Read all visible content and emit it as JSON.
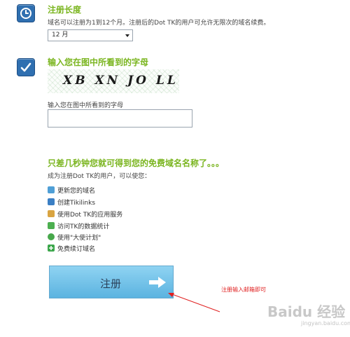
{
  "sections": {
    "duration": {
      "title": "注册长度",
      "description": "域名可以注册为1到12个月。注册后的Dot TK的用户可允许无限次的域名续费。",
      "selected_option": "12 月",
      "icon": "clock-icon"
    },
    "captcha": {
      "title": "输入您在图中所看到的字母",
      "captcha_text": "XB XN JO LL",
      "input_label": "输入您在图中所看到的字母",
      "input_value": "",
      "icon": "checkmark-icon"
    },
    "benefits": {
      "title": "只差几秒钟您就可得到您的免费域名名称了。。。",
      "intro": "成为注册Dot TK的用户，可以使您：",
      "items": [
        {
          "label": "更新您的域名",
          "icon": "refresh-icon",
          "color": "#4f9fd6"
        },
        {
          "label": "创建Tikilinks",
          "icon": "link-icon",
          "color": "#3b7fc4"
        },
        {
          "label": "使用Dot TK的应用服务",
          "icon": "box-icon",
          "color": "#d9a441"
        },
        {
          "label": "访问TK的数据统计",
          "icon": "chart-icon",
          "color": "#4caf50"
        },
        {
          "label": "使用\"大使计划\"",
          "icon": "shield-check-icon",
          "color": "#47a84b"
        },
        {
          "label": "免费续订域名",
          "icon": "plus-icon",
          "color": "#3aa64a"
        }
      ]
    }
  },
  "register_button": {
    "label": "注册",
    "icon": "arrow-right-icon"
  },
  "annotation": "注册输入邮箱即可",
  "watermark": {
    "text": "Baidu 经验",
    "sub": "jingyan.baidu.com"
  },
  "colors": {
    "accent_green": "#7ab51f",
    "icon_blue": "#2f6fb0",
    "annotation_red": "#e02020"
  }
}
